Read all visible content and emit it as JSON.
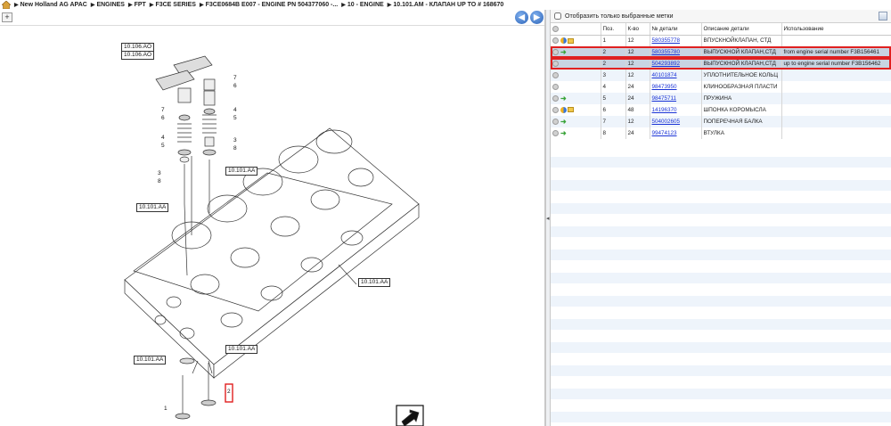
{
  "breadcrumb": [
    "New Holland AG APAC",
    "ENGINES",
    "FPT",
    "F3CE SERIES",
    "F3CE0684B E007 - ENGINE PN 504377060 -...",
    "10 - ENGINE",
    "10.101.AM - КЛАПАН UP TO # 168670"
  ],
  "left": {
    "expand_glyph": "+",
    "nav_back_glyph": "◀",
    "nav_forward_glyph": "▶",
    "callouts": [
      "10.106.AO",
      "10.106.AO",
      "10.101.AA",
      "10.101.AA",
      "10.101.AA",
      "10.101.AA",
      "10.101.AA"
    ],
    "numbers": [
      "7",
      "6",
      "7",
      "6",
      "4",
      "5",
      "4",
      "5",
      "3",
      "8",
      "3",
      "8",
      "1",
      "2"
    ]
  },
  "right": {
    "filter_label": "Отобразить только выбранные метки",
    "columns": [
      "",
      "Поз.",
      "К-во",
      "№ детали",
      "Описание детали",
      "Использование"
    ],
    "rows": [
      {
        "icons": [
          "circle",
          "pie",
          "box"
        ],
        "pos": "1",
        "qty": "12",
        "part": "580355778",
        "desc": "ВПУСКНОЙКЛАПАН, СТД",
        "usage": ""
      },
      {
        "icons": [
          "circle",
          "arrow"
        ],
        "pos": "2",
        "qty": "12",
        "part": "580355780",
        "desc": "ВЫПУСКНОЙ КЛАПАН,СТД",
        "usage": "from engine serial number F3B156461"
      },
      {
        "icons": [
          "circle"
        ],
        "pos": "2",
        "qty": "12",
        "part": "504293892",
        "desc": "ВЫПУСКНОЙ КЛАПАН,СТД",
        "usage": "up to engine serial number  F3B156462"
      },
      {
        "icons": [
          "circle"
        ],
        "pos": "3",
        "qty": "12",
        "part": "40101874",
        "desc": "УПЛОТНИТЕЛЬНОЕ КОЛЬЦ",
        "usage": ""
      },
      {
        "icons": [
          "circle"
        ],
        "pos": "4",
        "qty": "24",
        "part": "98473950",
        "desc": "КЛИНООБРАЗНАЯ ПЛАСТИ",
        "usage": ""
      },
      {
        "icons": [
          "circle",
          "arrow"
        ],
        "pos": "5",
        "qty": "24",
        "part": "98475711",
        "desc": "ПРУЖИНА",
        "usage": ""
      },
      {
        "icons": [
          "circle",
          "pie",
          "box"
        ],
        "pos": "6",
        "qty": "48",
        "part": "14196370",
        "desc": "ШПОНКА КОРОМЫСЛА",
        "usage": ""
      },
      {
        "icons": [
          "circle",
          "arrow"
        ],
        "pos": "7",
        "qty": "12",
        "part": "504002605",
        "desc": "ПОПЕРЕЧНАЯ БАЛКА",
        "usage": ""
      },
      {
        "icons": [
          "circle",
          "arrow"
        ],
        "pos": "8",
        "qty": "24",
        "part": "99474123",
        "desc": "ВТУЛКА",
        "usage": ""
      }
    ]
  },
  "colors": {
    "selection": "#c8d4e2",
    "highlight_border": "#e02020",
    "link": "#1a33d6",
    "row_alt": "#eef4fb"
  }
}
